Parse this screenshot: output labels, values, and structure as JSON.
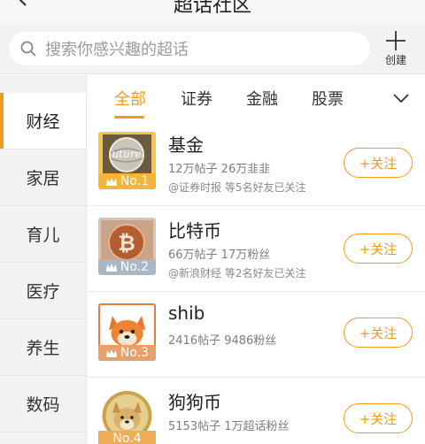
{
  "header": {
    "title": "超话社区",
    "back_icon": "back-arrow-icon",
    "more_icon": "more-icon"
  },
  "search": {
    "placeholder": "搜索你感兴趣的超话",
    "icon": "search-icon"
  },
  "create": {
    "label": "创建",
    "icon": "plus-icon"
  },
  "sidebar": {
    "items": [
      {
        "label": "财经",
        "active": true
      },
      {
        "label": "家居"
      },
      {
        "label": "育儿"
      },
      {
        "label": "医疗"
      },
      {
        "label": "养生"
      },
      {
        "label": "数码"
      }
    ]
  },
  "tabs": {
    "items": [
      "全部",
      "证券",
      "金融",
      "股票"
    ],
    "active": "全部",
    "expand_icon": "chevron-down-icon"
  },
  "topics": [
    {
      "name": "基金",
      "rank": "No.1",
      "stats": "12万帖子 26万韭韭",
      "friends": "@证券时报 等5名好友已关注",
      "follow": "+关注",
      "rank_color": "#f5b43a"
    },
    {
      "name": "比特币",
      "rank": "No.2",
      "stats": "66万帖子 17万粉丝",
      "friends": "@新浪财经 等2名好友已关注",
      "follow": "+关注",
      "rank_color": "#a9b8c7"
    },
    {
      "name": "shib",
      "rank": "No.3",
      "stats": "2416帖子 9486粉丝",
      "friends": "",
      "follow": "+关注",
      "rank_color": "#e8a06a"
    },
    {
      "name": "狗狗币",
      "rank": "No.4",
      "stats": "5153帖子 1万超话粉丝",
      "friends": "",
      "follow": "+关注",
      "rank_color": "#f0ab55"
    }
  ],
  "colors": {
    "accent": "#f29a1c",
    "sidebar_bg": "#f2f2f2"
  }
}
